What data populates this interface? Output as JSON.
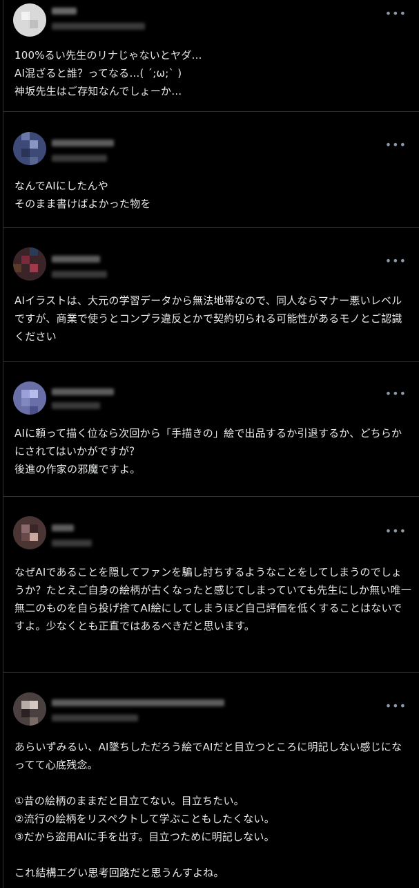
{
  "icons": {
    "more": "more-horizontal-icon",
    "more_glyph": "•••"
  },
  "colors": {
    "background": "#000000",
    "text": "#e7e9ea",
    "muted": "#8b98a5",
    "divider": "#2f3336"
  },
  "posts": [
    {
      "text": "100%るい先生のリナじゃないとヤダ…\nAI混ざると誰？ってなる…( ´;ω;` )\n神坂先生はご存知なんでしょーか…"
    },
    {
      "text": "なんでAIにしたんや\nそのまま書けばよかった物を"
    },
    {
      "text": "AIイラストは、大元の学習データから無法地帯なので、同人ならマナー悪いレベルですが、商業で使うとコンプラ違反とかで契約切られる可能性があるモノとご認識ください"
    },
    {
      "text": "AIに頼って描く位なら次回から「手描きの」絵で出品するか引退するか、どちらかにされてはいかがですが？\n後進の作家の邪魔ですよ。"
    },
    {
      "text": "なぜAIであることを隠してファンを騙し討ちするようなことをしてしまうのでしょうか？たとえご自身の絵柄が古くなったと感じてしまっていても先生にしか無い唯一無二のものを自ら投げ捨てAI絵にしてしまうほど自己評価を低くすることはないですよ。少なくとも正直ではあるべきだと思います。"
    },
    {
      "text": "あらいずみるい、AI墜ちしただろう絵でAIだと目立つところに明記しない感じになってて心底残念。\n\n①昔の絵柄のままだと目立てない。目立ちたい。\n②流行の絵柄をリスペクトして学ぶこともしたくない。\n③だから盗用AIに手を出す。目立つために明記しない。\n\nこれ結構エグい思考回路だと思うんすよね。"
    }
  ]
}
